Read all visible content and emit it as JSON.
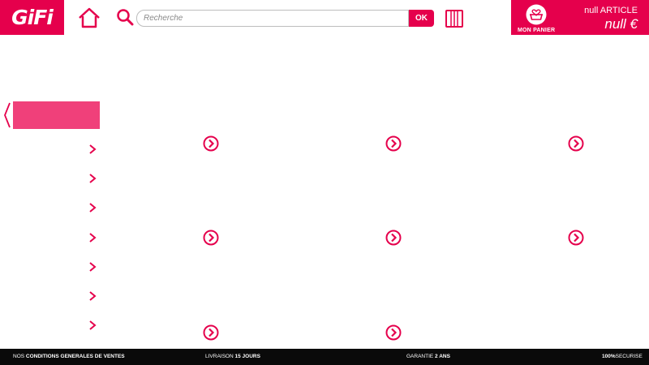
{
  "header": {
    "logo_text": "GiFi",
    "search": {
      "placeholder": "Recherche",
      "value": "",
      "button_label": "OK"
    },
    "cart": {
      "label": "MON PANIER",
      "count_text": "null ARTICLE",
      "total_text": "null €"
    }
  },
  "colors": {
    "brand": "#e5004c",
    "nav_active": "#f0407a",
    "footer_bg": "#0a0a0a"
  },
  "nav": {
    "item_count_label": ""
  },
  "footer": {
    "cgv_prefix": "NOS",
    "cgv_bold": "CONDITIONS GENERALES DE VENTES",
    "delivery_prefix": "LIVRAISON",
    "delivery_bold": "15 JOURS",
    "warranty_prefix": "GARANTIE",
    "warranty_bold": "2 ANS",
    "secure_bold": "100%",
    "secure_suffix": "SECURISE"
  }
}
